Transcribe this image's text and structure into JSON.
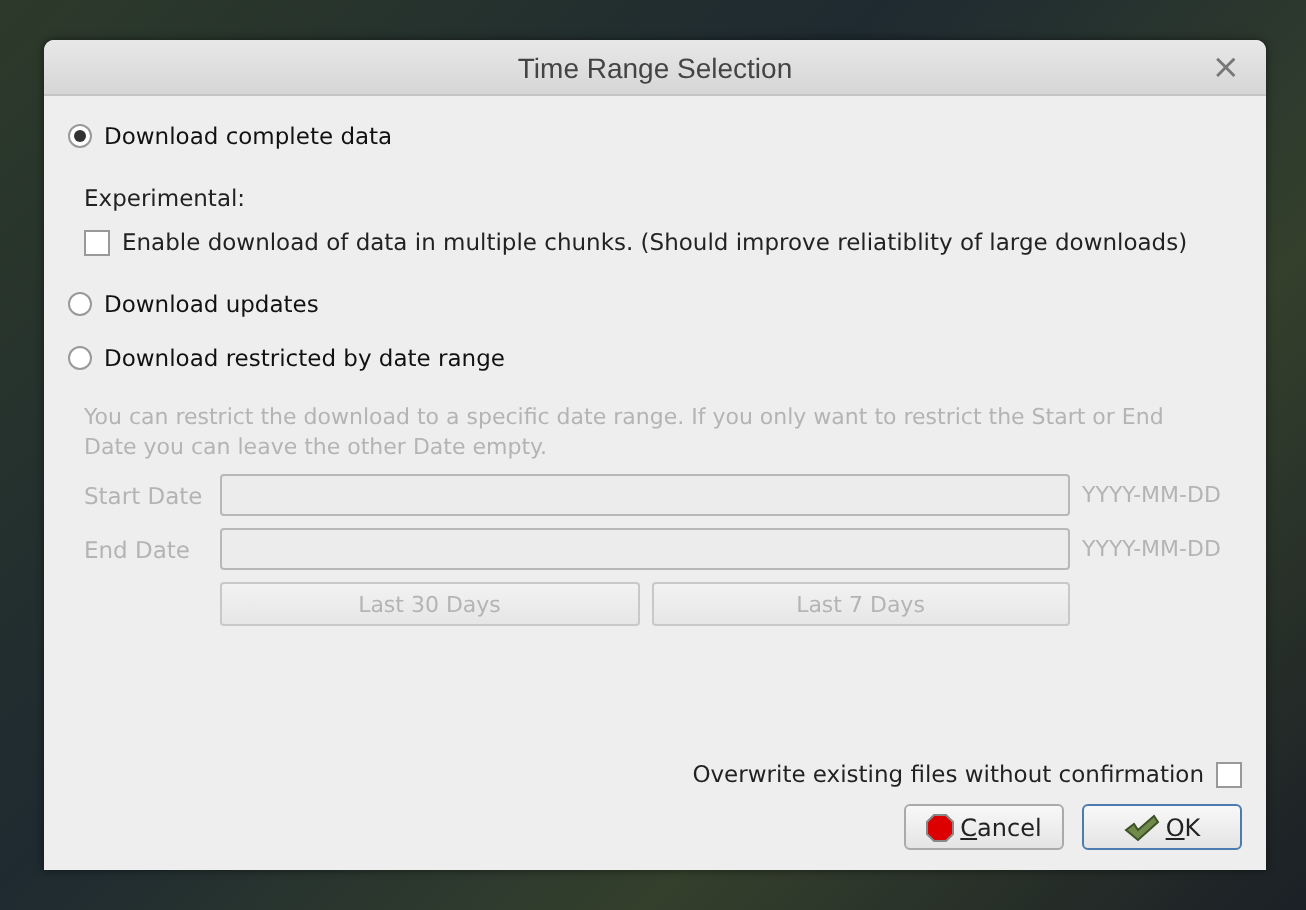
{
  "window": {
    "title": "Time Range Selection",
    "close": "×"
  },
  "options": [
    {
      "label": "Download complete data",
      "selected": true
    },
    {
      "label": "Download updates",
      "selected": false
    },
    {
      "label": "Download restricted by date range",
      "selected": false
    }
  ],
  "experimental": {
    "heading": "Experimental:",
    "checkbox": {
      "label": "Enable download of data in multiple chunks. (Should improve reliatiblity of large downloads)",
      "checked": false
    }
  },
  "date_range": {
    "disabled": true,
    "description": "You can restrict the download to a specific date range. If you only want to restrict the Start or End Date you can leave the other Date empty.",
    "fields": [
      {
        "label": "Start Date",
        "format": "YYYY-MM-DD"
      },
      {
        "label": "End Date",
        "format": "YYYY-MM-DD"
      }
    ],
    "buttons": [
      "Last 30 Days",
      "Last 7 Days"
    ]
  },
  "overwrite": {
    "label": "Overwrite existing files without confirmation",
    "checked": false
  },
  "buttons": [
    {
      "label": "Cancel",
      "kind": "cancel"
    },
    {
      "label": "OK",
      "kind": "ok"
    }
  ]
}
